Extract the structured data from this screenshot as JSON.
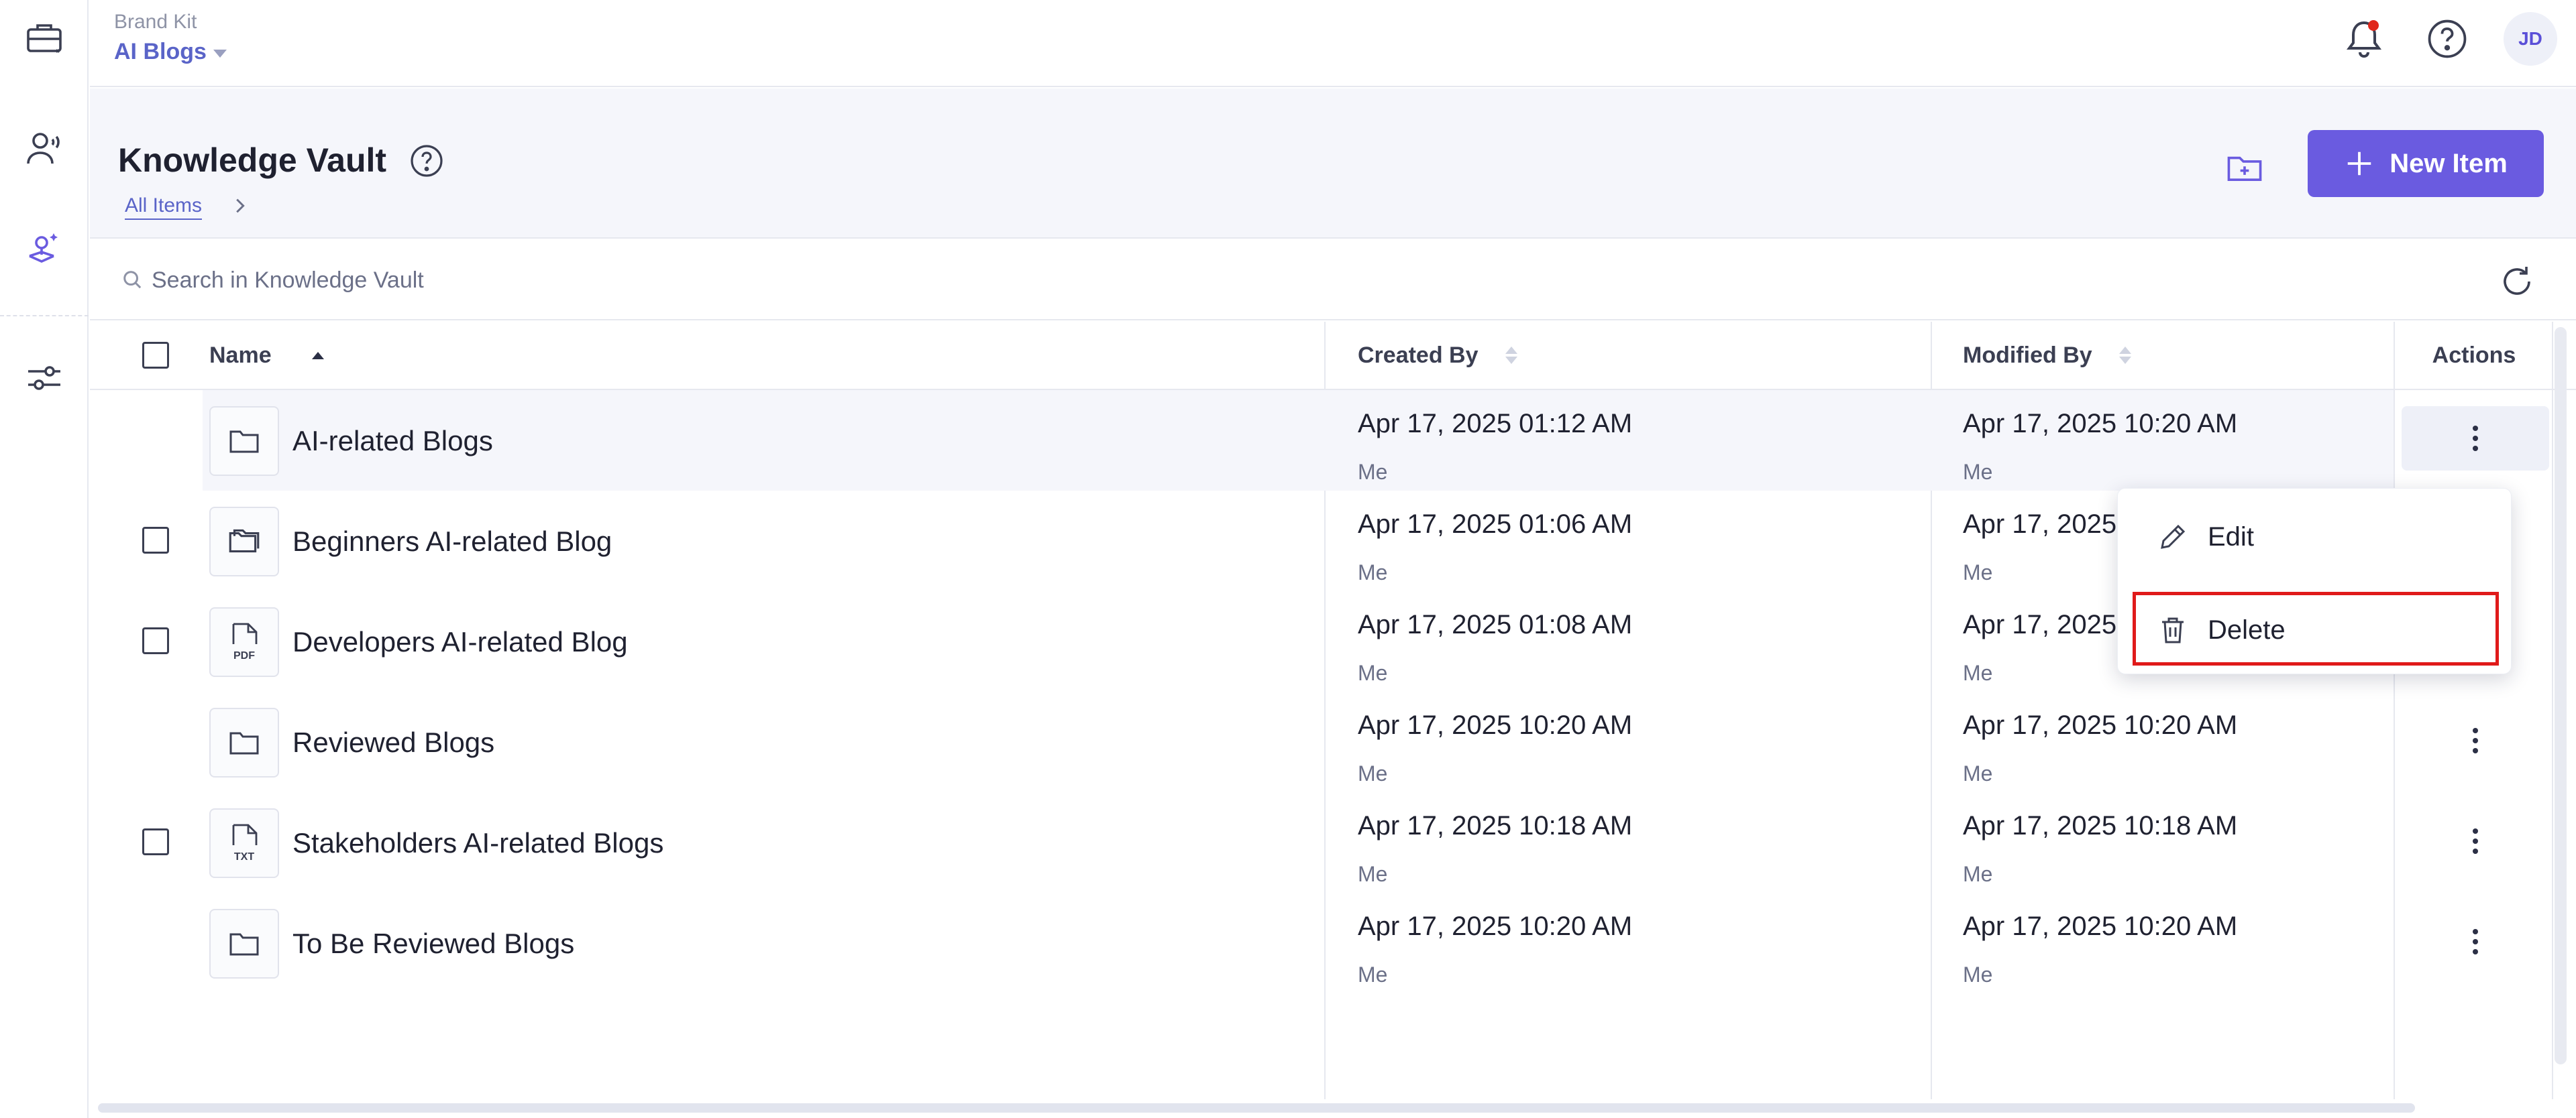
{
  "topbar": {
    "brand_caption": "Brand Kit",
    "brand_name": "AI Blogs",
    "avatar_initials": "JD",
    "notification_dot_color": "#e0271b"
  },
  "header": {
    "title": "Knowledge Vault",
    "breadcrumb": "All Items",
    "new_item_label": "New Item",
    "accent_color": "#6a5be0"
  },
  "search": {
    "placeholder": "Search in Knowledge Vault"
  },
  "table": {
    "columns": {
      "name": "Name",
      "created": "Created By",
      "modified": "Modified By",
      "actions": "Actions"
    },
    "rows": [
      {
        "name": "AI-related Blogs",
        "icon": "folder",
        "created": "Apr 17, 2025 01:12 AM",
        "created_by": "Me",
        "modified": "Apr 17, 2025 10:20 AM",
        "modified_by": "Me"
      },
      {
        "name": "Beginners AI-related Blog",
        "icon": "folder-stack",
        "created": "Apr 17, 2025 01:06 AM",
        "created_by": "Me",
        "modified": "Apr 17, 2025",
        "modified_by": "Me"
      },
      {
        "name": "Developers AI-related Blog",
        "icon": "pdf",
        "created": "Apr 17, 2025 01:08 AM",
        "created_by": "Me",
        "modified": "Apr 17, 2025",
        "modified_by": "Me"
      },
      {
        "name": "Reviewed Blogs",
        "icon": "folder",
        "created": "Apr 17, 2025 10:20 AM",
        "created_by": "Me",
        "modified": "Apr 17, 2025 10:20 AM",
        "modified_by": "Me"
      },
      {
        "name": "Stakeholders AI-related Blogs",
        "icon": "txt",
        "created": "Apr 17, 2025 10:18 AM",
        "created_by": "Me",
        "modified": "Apr 17, 2025 10:18 AM",
        "modified_by": "Me"
      },
      {
        "name": "To Be Reviewed Blogs",
        "icon": "folder",
        "created": "Apr 17, 2025 10:20 AM",
        "created_by": "Me",
        "modified": "Apr 17, 2025 10:20 AM",
        "modified_by": "Me"
      }
    ]
  },
  "file_labels": {
    "pdf": "PDF",
    "txt": "TXT"
  },
  "context_menu": {
    "edit": "Edit",
    "delete": "Delete",
    "highlight_color": "#e01a1a"
  }
}
